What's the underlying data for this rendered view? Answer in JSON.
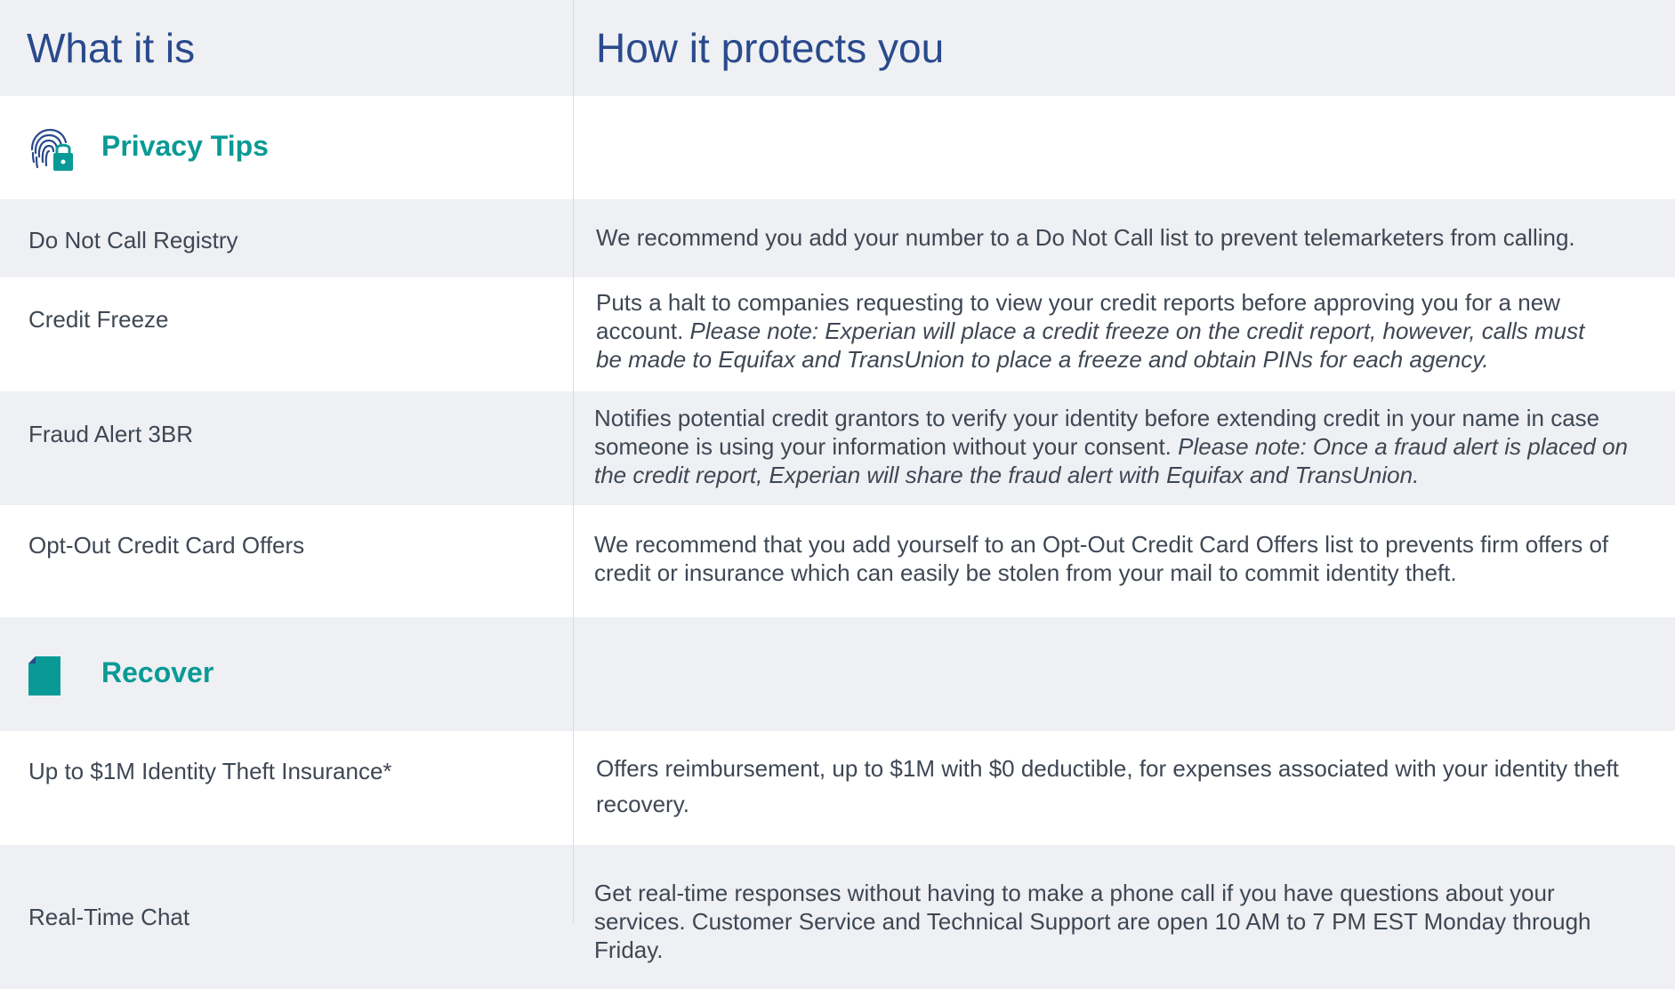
{
  "header": {
    "col_left": "What it is",
    "col_right": "How it protects you"
  },
  "sections": [
    {
      "title": "Privacy Tips",
      "icon": "fingerprint-lock-icon",
      "rows": [
        {
          "name": "Do Not Call Registry",
          "desc": "We recommend you add your number to a Do Not Call list to prevent telemarketers from calling."
        },
        {
          "name": "Credit Freeze",
          "desc": "Puts a halt to companies requesting to view your credit reports before approving you for a new account.",
          "note": "Please note: Experian will place a credit freeze on the credit report, however, calls must be made to Equifax and TransUnion to place a freeze and obtain PINs for each agency."
        },
        {
          "name": "Fraud Alert 3BR",
          "desc": "Notifies potential credit grantors to verify your identity before extending credit in your name in case someone is using your information without your consent.",
          "note": "Please note: Once a fraud alert is placed on the credit report, Experian will share the fraud alert with Equifax and TransUnion."
        },
        {
          "name": "Opt-Out Credit Card Offers",
          "desc": "We recommend that you add yourself to an Opt-Out Credit Card Offers list to prevents firm offers of credit or insurance which can easily be stolen from your mail to commit identity theft."
        }
      ]
    },
    {
      "title": "Recover",
      "icon": "document-icon",
      "rows": [
        {
          "name": "Up to $1M Identity Theft Insurance*",
          "desc": "Offers reimbursement, up to $1M with $0 deductible, for expenses associated with your identity theft recovery."
        },
        {
          "name": "Real-Time Chat",
          "desc": "Get real-time responses without having to make a phone call if you have questions about your services. Customer Service and Technical Support are open 10 AM to 7 PM EST Monday through Friday."
        }
      ]
    }
  ],
  "colors": {
    "header_text": "#2a4a8c",
    "section_title": "#0a9a96",
    "band_gray": "#eef0f3",
    "body_text": "#3f4754"
  }
}
